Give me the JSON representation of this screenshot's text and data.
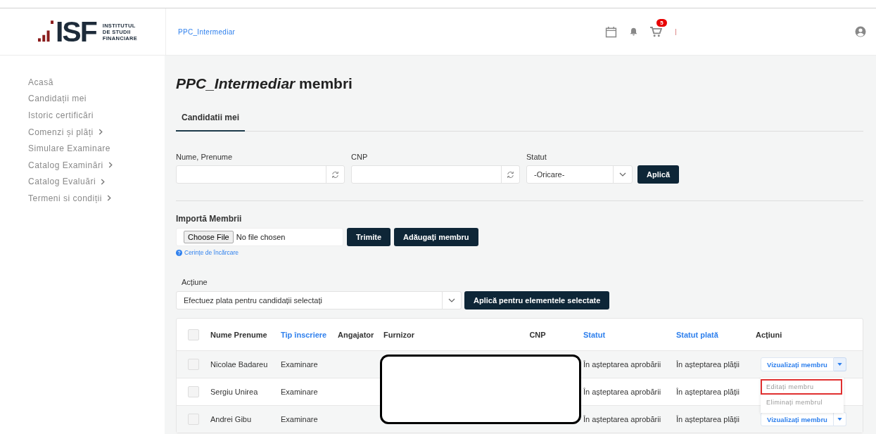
{
  "header": {
    "logo": {
      "mark": "ISF",
      "lines": [
        "INSTITUTUL",
        "DE STUDII",
        "FINANCIARE"
      ]
    },
    "breadcrumb": "PPC_Intermediar",
    "cart_count": "5"
  },
  "sidebar": {
    "items": [
      {
        "label": "Acasă",
        "has_submenu": false
      },
      {
        "label": "Candidații mei",
        "has_submenu": false
      },
      {
        "label": "Istoric certificări",
        "has_submenu": false
      },
      {
        "label": "Comenzi și plăți",
        "has_submenu": true
      },
      {
        "label": "Simulare Examinare",
        "has_submenu": false
      },
      {
        "label": "Catalog Examinări",
        "has_submenu": true
      },
      {
        "label": "Catalog Evaluări",
        "has_submenu": true
      },
      {
        "label": "Termeni si condiții",
        "has_submenu": true
      }
    ]
  },
  "page_title": "*PPC_Intermediar* membri",
  "tabs": [
    {
      "label": "Candidatii mei",
      "selected": true
    }
  ],
  "filters": [
    {
      "label": "Nume, Prenume",
      "kind": "text"
    },
    {
      "label": "CNP",
      "kind": "text"
    },
    {
      "label": "Statut",
      "kind": "select",
      "value": "-Oricare-"
    }
  ],
  "filter_button": "Aplică",
  "import": {
    "title": "Importă Membrii",
    "choose_button": "Choose File",
    "file_status": "No file chosen",
    "submit_button": "Trimite",
    "add_button": "Adăugați membru",
    "help_link": "Cerințe de încărcare"
  },
  "bulk_action": {
    "label": "Acțiune",
    "value": "Efectuez plata pentru candidații selectați",
    "button": "Aplică pentru elementele selectate"
  },
  "table": {
    "header_checked": false,
    "columns": [
      {
        "label": "Nume Prenume",
        "sortable": false
      },
      {
        "label": "Tip înscriere",
        "sortable": true
      },
      {
        "label": "Angajator",
        "sortable": false
      },
      {
        "label": "Furnizor",
        "sortable": false
      },
      {
        "label": "CNP",
        "sortable": false
      },
      {
        "label": "Statut",
        "sortable": true
      },
      {
        "label": "Statut plată",
        "sortable": true
      },
      {
        "label": "Acțiuni",
        "sortable": false
      }
    ],
    "rows": [
      {
        "checked": false,
        "cells": [
          "Nicolae Badareu",
          "Examinare",
          "",
          "",
          "",
          "În așteptarea aprobării",
          "În așteptarea plății"
        ],
        "action": "Vizualizați membru",
        "menu_open": true
      },
      {
        "checked": false,
        "cells": [
          "Sergiu Unirea",
          "Examinare",
          "",
          "",
          "",
          "În așteptarea aprobării",
          "În așteptarea plății"
        ],
        "menu_open": false
      },
      {
        "checked": false,
        "cells": [
          "Andrei Gibu",
          "Examinare",
          "",
          "",
          "",
          "În așteptarea aprobării",
          "În așteptarea plății"
        ],
        "action": "Vizualizați membru",
        "menu_open": false
      }
    ],
    "menu": [
      {
        "label": "Editați membru",
        "highlighted": true
      },
      {
        "label": "Eliminați membrul",
        "highlighted": false
      }
    ]
  }
}
